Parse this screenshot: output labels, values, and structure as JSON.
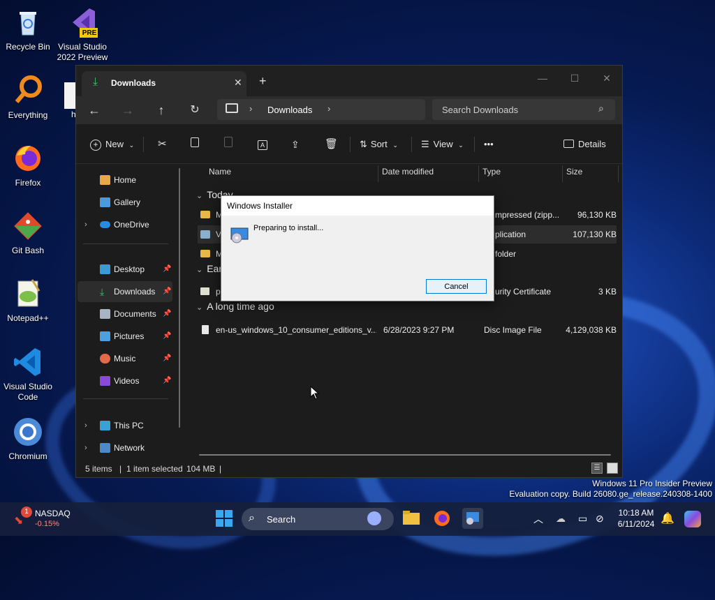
{
  "desktop": {
    "icons": [
      {
        "label": "Recycle Bin",
        "name": "recycle-bin"
      },
      {
        "label": "Visual Studio 2022 Preview",
        "name": "visual-studio-2022-preview",
        "badge": "PRE"
      },
      {
        "label": "Everything",
        "name": "everything"
      },
      {
        "label": "Firefox",
        "name": "firefox"
      },
      {
        "label": "Git Bash",
        "name": "git-bash"
      },
      {
        "label": "Notepad++",
        "name": "notepad-plus-plus"
      },
      {
        "label": "Visual Studio Code",
        "name": "visual-studio-code"
      },
      {
        "label": "Chromium",
        "name": "chromium"
      }
    ],
    "partial_label": "h"
  },
  "explorer": {
    "tab_title": "Downloads",
    "new_tab": "+",
    "breadcrumb": "Downloads",
    "search_placeholder": "Search Downloads",
    "toolbar": {
      "new": "New",
      "sort": "Sort",
      "view": "View",
      "more": "•••",
      "details": "Details"
    },
    "sidebar": {
      "home": "Home",
      "gallery": "Gallery",
      "onedrive": "OneDrive",
      "desktop": "Desktop",
      "downloads": "Downloads",
      "documents": "Documents",
      "pictures": "Pictures",
      "music": "Music",
      "videos": "Videos",
      "thispc": "This PC",
      "network": "Network"
    },
    "columns": {
      "name": "Name",
      "date": "Date modified",
      "type": "Type",
      "size": "Size"
    },
    "groups": {
      "today": "Today",
      "earlier": "Earl",
      "long_ago": "A long time ago"
    },
    "rows": [
      {
        "name": "M",
        "date": "",
        "type": "mpressed (zipp...",
        "size": "96,130 KB"
      },
      {
        "name": "Vi",
        "date": "",
        "type": "plication",
        "size": "107,130 KB"
      },
      {
        "name": "M",
        "date": "",
        "type": "folder",
        "size": ""
      },
      {
        "name": "pc",
        "date": "",
        "type": "urity Certificate",
        "size": "3 KB"
      },
      {
        "name": "en-us_windows_10_consumer_editions_v...",
        "date": "6/28/2023 9:27 PM",
        "type": "Disc Image File",
        "size": "4,129,038 KB"
      }
    ],
    "status": {
      "items": "5 items",
      "selected": "1 item selected",
      "size": "104 MB"
    }
  },
  "dialog": {
    "title": "Windows Installer",
    "message": "Preparing to install...",
    "cancel": "Cancel"
  },
  "watermark": {
    "line1": "Windows 11 Pro Insider Preview",
    "line2": "Evaluation copy. Build 26080.ge_release.240308-1400"
  },
  "taskbar": {
    "stock_name": "NASDAQ",
    "stock_change": "-0.15%",
    "stock_badge": "1",
    "search": "Search",
    "time": "10:18 AM",
    "date": "6/11/2024"
  }
}
